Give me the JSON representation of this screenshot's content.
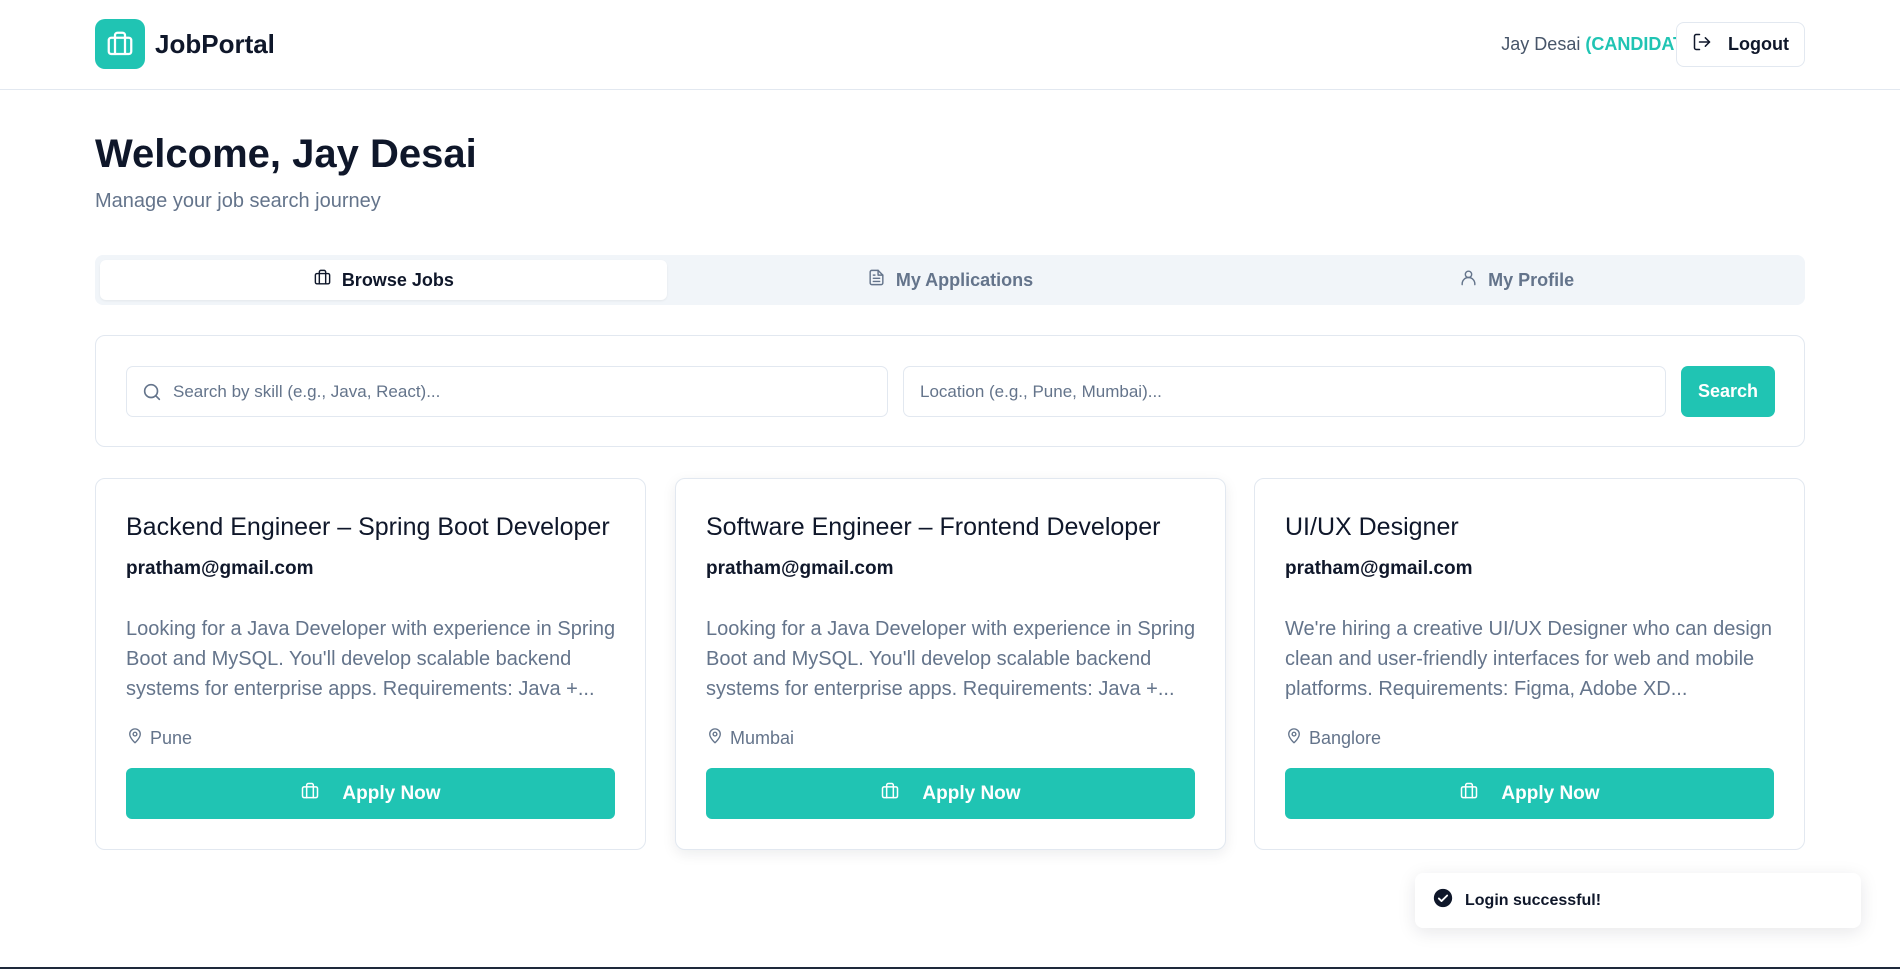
{
  "brand": {
    "name": "JobPortal"
  },
  "header": {
    "user_name": "Jay Desai",
    "user_role": "(CANDIDATE)",
    "logout_label": "Logout"
  },
  "welcome": {
    "title": "Welcome, Jay Desai",
    "subtitle": "Manage your job search journey"
  },
  "tabs": [
    {
      "label": "Browse Jobs",
      "icon": "briefcase-icon",
      "active": true
    },
    {
      "label": "My Applications",
      "icon": "document-icon",
      "active": false
    },
    {
      "label": "My Profile",
      "icon": "user-icon",
      "active": false
    }
  ],
  "search": {
    "skill_placeholder": "Search by skill (e.g., Java, React)...",
    "location_placeholder": "Location (e.g., Pune, Mumbai)...",
    "button_label": "Search"
  },
  "jobs": [
    {
      "title": "Backend Engineer – Spring Boot Developer",
      "email": "pratham@gmail.com",
      "description": "Looking for a Java Developer with experience in Spring Boot and MySQL. You'll develop scalable backend systems for enterprise apps. Requirements: Java +...",
      "location": "Pune",
      "apply_label": "Apply Now"
    },
    {
      "title": "Software Engineer – Frontend Developer",
      "email": "pratham@gmail.com",
      "description": "Looking for a Java Developer with experience in Spring Boot and MySQL. You'll develop scalable backend systems for enterprise apps. Requirements: Java +...",
      "location": "Mumbai",
      "apply_label": "Apply Now"
    },
    {
      "title": "UI/UX Designer",
      "email": "pratham@gmail.com",
      "description": "We're hiring a creative UI/UX Designer who can design clean and user-friendly interfaces for web and mobile platforms. Requirements: Figma, Adobe XD...",
      "location": "Banglore",
      "apply_label": "Apply Now"
    }
  ],
  "toast": {
    "message": "Login successful!"
  },
  "colors": {
    "accent": "#20c4b3",
    "text": "#0f172a",
    "muted": "#64748b",
    "border": "#e2e8f0"
  }
}
